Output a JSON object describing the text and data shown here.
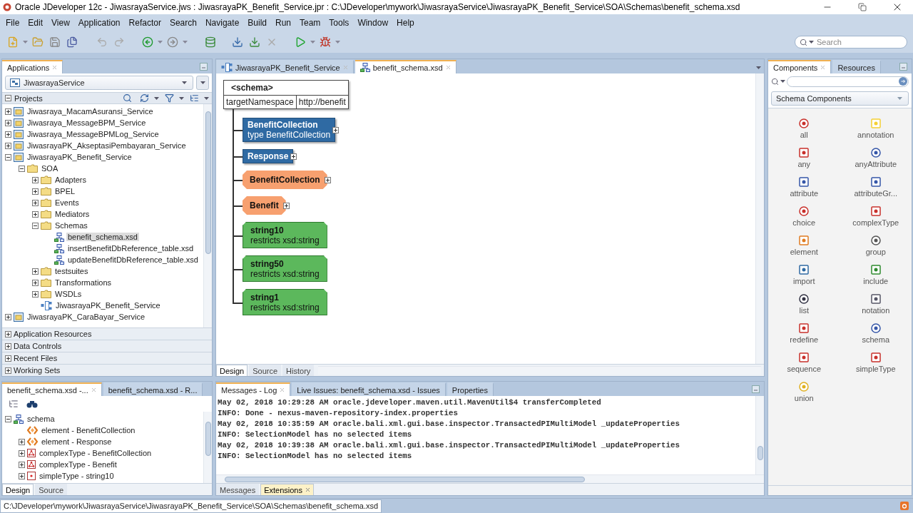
{
  "window": {
    "title": "Oracle JDeveloper 12c - JiwasrayaService.jws : JiwasrayaPK_Benefit_Service.jpr : C:\\JDeveloper\\mywork\\JiwasrayaService\\JiwasrayaPK_Benefit_Service\\SOA\\Schemas\\benefit_schema.xsd"
  },
  "menu": [
    "File",
    "Edit",
    "View",
    "Application",
    "Refactor",
    "Search",
    "Navigate",
    "Build",
    "Run",
    "Team",
    "Tools",
    "Window",
    "Help"
  ],
  "search": {
    "placeholder": "Search"
  },
  "applications": {
    "title": "Applications",
    "app": "JiwasrayaService",
    "projects_label": "Projects",
    "tree": [
      {
        "label": "Jiwasraya_MacamAsuransi_Service",
        "kind": "project",
        "expanded": false,
        "selected": false
      },
      {
        "label": "Jiwasraya_MessageBPM_Service",
        "kind": "project",
        "expanded": false,
        "selected": false
      },
      {
        "label": "Jiwasraya_MessageBPMLog_Service",
        "kind": "project",
        "expanded": false,
        "selected": false
      },
      {
        "label": "JiwasrayaPK_AkseptasiPembayaran_Service",
        "kind": "project",
        "expanded": false,
        "selected": false
      },
      {
        "label": "JiwasrayaPK_Benefit_Service",
        "kind": "project",
        "expanded": true,
        "selected": false,
        "children": [
          {
            "label": "SOA",
            "kind": "folder",
            "expanded": true,
            "selected": false,
            "children": [
              {
                "label": "Adapters",
                "kind": "folder",
                "expanded": false,
                "selected": false
              },
              {
                "label": "BPEL",
                "kind": "folder",
                "expanded": false,
                "selected": false
              },
              {
                "label": "Events",
                "kind": "folder",
                "expanded": false,
                "selected": false
              },
              {
                "label": "Mediators",
                "kind": "folder",
                "expanded": false,
                "selected": false
              },
              {
                "label": "Schemas",
                "kind": "folder",
                "expanded": true,
                "selected": false,
                "children": [
                  {
                    "label": "benefit_schema.xsd",
                    "kind": "xsd",
                    "selected": true
                  },
                  {
                    "label": "insertBenefitDbReference_table.xsd",
                    "kind": "xsd",
                    "selected": false
                  },
                  {
                    "label": "updateBenefitDbReference_table.xsd",
                    "kind": "xsd",
                    "selected": false
                  }
                ]
              },
              {
                "label": "testsuites",
                "kind": "folder",
                "expanded": false,
                "selected": false
              },
              {
                "label": "Transformations",
                "kind": "folder",
                "expanded": false,
                "selected": false
              },
              {
                "label": "WSDLs",
                "kind": "folder",
                "expanded": false,
                "selected": false
              },
              {
                "label": "JiwasrayaPK_Benefit_Service",
                "kind": "composite",
                "selected": false
              }
            ]
          }
        ]
      },
      {
        "label": "JiwasrayaPK_CaraBayar_Service",
        "kind": "project",
        "expanded": false,
        "selected": false
      }
    ],
    "sections": [
      "Application Resources",
      "Data Controls",
      "Recent Files",
      "Working Sets"
    ]
  },
  "editor": {
    "tabs": [
      {
        "label": "JiwasrayaPK_Benefit_Service",
        "kind": "composite",
        "selected": false
      },
      {
        "label": "benefit_schema.xsd",
        "kind": "xsd",
        "selected": true
      }
    ],
    "schema": {
      "title": "<schema>",
      "attribute": "targetNamespace",
      "value": "http://benefit",
      "nodes": [
        {
          "kind": "element",
          "name": "BenefitCollection",
          "detail": "type  BenefitCollection",
          "expandable": true
        },
        {
          "kind": "element",
          "name": "Response",
          "expandable": true
        },
        {
          "kind": "complexType",
          "name": "BenefitCollection",
          "expandable": true
        },
        {
          "kind": "complexType",
          "name": "Benefit",
          "expandable": true
        },
        {
          "kind": "simpleType",
          "name": "string10",
          "detail": "restricts  xsd:string",
          "expandable": false
        },
        {
          "kind": "simpleType",
          "name": "string50",
          "detail": "restricts  xsd:string",
          "expandable": false
        },
        {
          "kind": "simpleType",
          "name": "string1",
          "detail": "restricts  xsd:string",
          "expandable": false
        }
      ]
    },
    "bottom_tabs": [
      {
        "label": "Design",
        "selected": true
      },
      {
        "label": "Source",
        "selected": false
      },
      {
        "label": "History",
        "selected": false
      }
    ]
  },
  "structure": {
    "tabs": [
      {
        "label": "benefit_schema.xsd -...",
        "selected": true
      },
      {
        "label": "benefit_schema.xsd - R...",
        "selected": false
      }
    ],
    "tree": [
      {
        "label": "schema",
        "kind": "schema",
        "expanded": true,
        "selected": false,
        "children": [
          {
            "label": "element - BenefitCollection",
            "kind": "element",
            "selected": false
          },
          {
            "label": "element - Response",
            "kind": "element",
            "expanded": false,
            "selected": false
          },
          {
            "label": "complexType - BenefitCollection",
            "kind": "complexType",
            "expanded": false,
            "selected": false
          },
          {
            "label": "complexType - Benefit",
            "kind": "complexType",
            "expanded": false,
            "selected": false
          },
          {
            "label": "simpleType - string10",
            "kind": "simpleType",
            "expanded": false,
            "selected": false
          }
        ]
      }
    ],
    "bottom_tabs": [
      {
        "label": "Design",
        "selected": true
      },
      {
        "label": "Source",
        "selected": false
      }
    ]
  },
  "log": {
    "tabs": [
      {
        "label": "Messages - Log",
        "selected": true
      },
      {
        "label": "Live Issues: benefit_schema.xsd - Issues",
        "selected": false
      },
      {
        "label": "Properties",
        "selected": false
      }
    ],
    "lines": [
      "May 02, 2018 10:29:28 AM oracle.jdeveloper.maven.util.MavenUtil$4 transferCompleted",
      "INFO: Done - nexus-maven-repository-index.properties",
      "May 02, 2018 10:35:59 AM oracle.bali.xml.gui.base.inspector.TransactedPIMultiModel _updateProperties",
      "INFO: SelectionModel has no selected items",
      "May 02, 2018 10:39:38 AM oracle.bali.xml.gui.base.inspector.TransactedPIMultiModel _updateProperties",
      "INFO: SelectionModel has no selected items"
    ],
    "bottom_tabs": [
      {
        "label": "Messages",
        "selected": false
      },
      {
        "label": "Extensions",
        "selected": true
      }
    ]
  },
  "palette": {
    "tabs": [
      {
        "label": "Components",
        "selected": true
      },
      {
        "label": "Resources",
        "selected": false
      }
    ],
    "category": "Schema Components",
    "items": [
      "all",
      "annotation",
      "any",
      "anyAttribute",
      "attribute",
      "attributeGr...",
      "choice",
      "complexType",
      "element",
      "group",
      "import",
      "include",
      "list",
      "notation",
      "redefine",
      "schema",
      "sequence",
      "simpleType",
      "union"
    ]
  },
  "status_bar": {
    "path": "C:\\JDeveloper\\mywork\\JiwasrayaService\\JiwasrayaPK_Benefit_Service\\SOA\\Schemas\\benefit_schema.xsd"
  }
}
